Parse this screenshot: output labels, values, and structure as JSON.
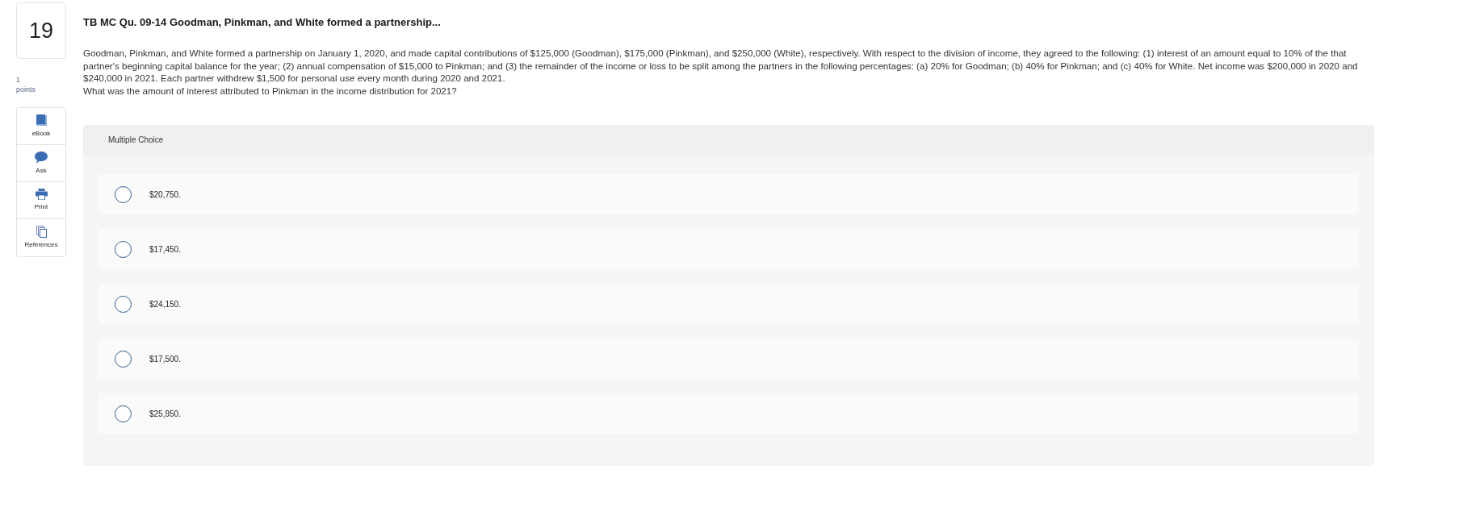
{
  "question": {
    "number": "19",
    "points_value": "1",
    "points_label": "points",
    "title": "TB MC Qu. 09-14 Goodman, Pinkman, and White formed a partnership...",
    "body": "Goodman, Pinkman, and White formed a partnership on January 1, 2020, and made capital contributions of $125,000 (Goodman), $175,000 (Pinkman), and $250,000 (White), respectively. With respect to the division of income, they agreed to the following: (1) interest of an amount equal to 10% of the that partner's beginning capital balance for the year; (2) annual compensation of $15,000 to Pinkman; and (3) the remainder of the income or loss to be split among the partners in the following percentages: (a) 20% for Goodman; (b) 40% for Pinkman; and (c) 40% for White. Net income was $200,000 in 2020 and $240,000 in 2021. Each partner withdrew $1,500 for personal use every month during 2020 and 2021.",
    "prompt": "What was the amount of interest attributed to Pinkman in the income distribution for 2021?"
  },
  "tools": [
    {
      "kind": "book",
      "label": "eBook"
    },
    {
      "kind": "ask",
      "label": "Ask"
    },
    {
      "kind": "print",
      "label": "Print"
    },
    {
      "kind": "references",
      "label": "References"
    }
  ],
  "answer_panel": {
    "heading": "Multiple Choice",
    "choices": [
      {
        "label": "$20,750.",
        "selected": false
      },
      {
        "label": "$17,450.",
        "selected": false
      },
      {
        "label": "$24,150.",
        "selected": false
      },
      {
        "label": "$17,500.",
        "selected": false
      },
      {
        "label": "$25,950.",
        "selected": false
      }
    ]
  }
}
